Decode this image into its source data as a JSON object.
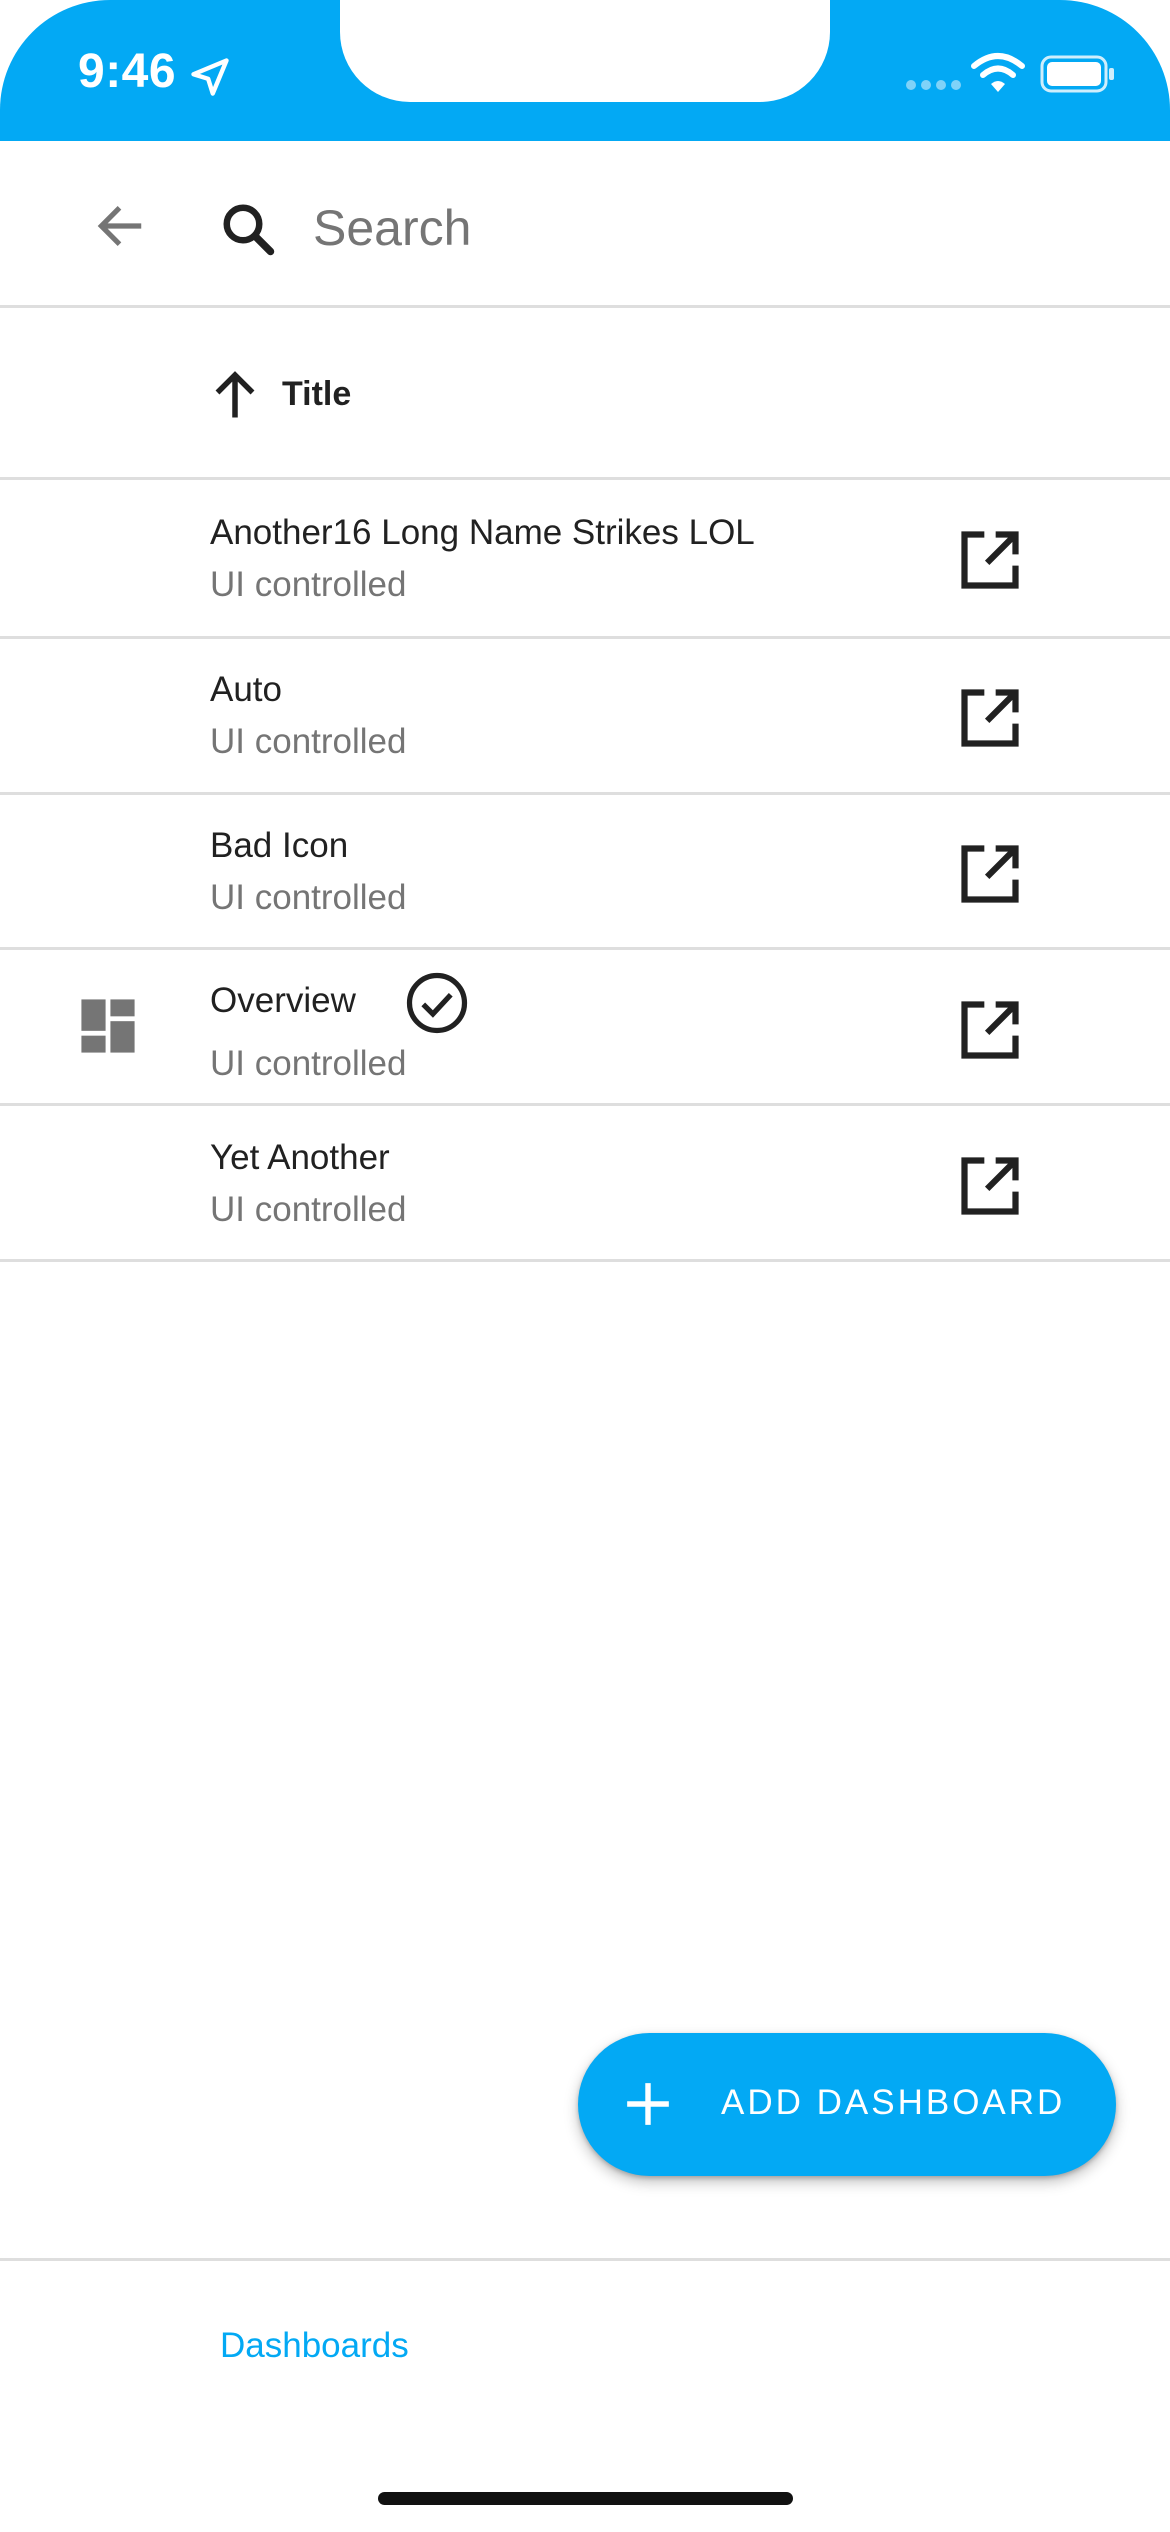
{
  "status_bar": {
    "time": "9:46"
  },
  "search": {
    "placeholder": "Search"
  },
  "sort": {
    "label": "Title"
  },
  "dashboards": [
    {
      "title": "Another16 Long Name Strikes LOL",
      "subtitle": "UI controlled"
    },
    {
      "title": "Auto",
      "subtitle": "UI controlled"
    },
    {
      "title": "Bad Icon",
      "subtitle": "UI controlled"
    },
    {
      "title": "Overview",
      "subtitle": "UI controlled"
    },
    {
      "title": "Yet Another",
      "subtitle": "UI controlled"
    }
  ],
  "fab": {
    "label": "ADD DASHBOARD"
  },
  "bottom_nav": {
    "tab": "Dashboards"
  },
  "colors": {
    "accent": "#03a9f4",
    "text": "#212121",
    "secondary": "#757575",
    "divider": "#dedede"
  }
}
